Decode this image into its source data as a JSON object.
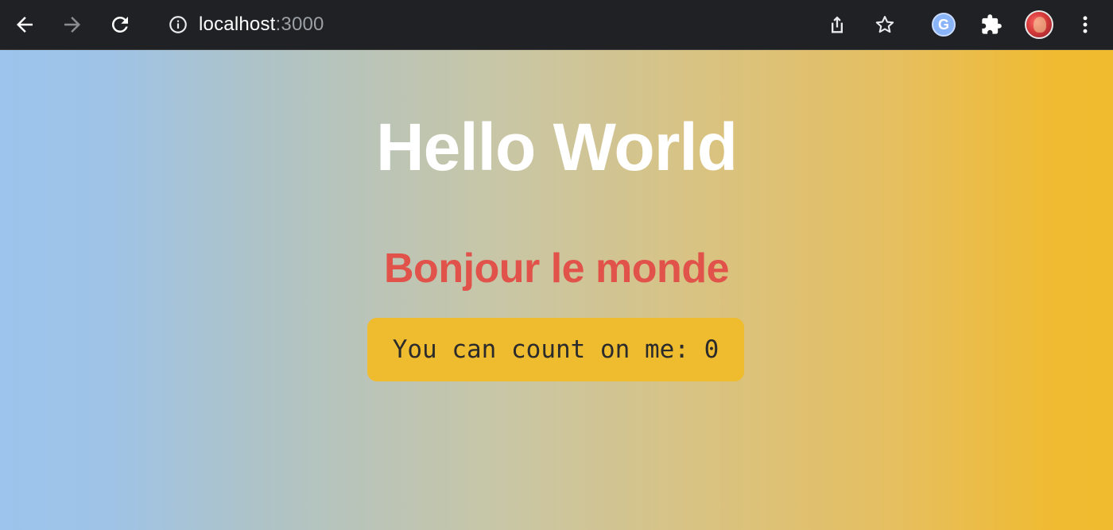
{
  "browser": {
    "url_host": "localhost",
    "url_port": ":3000",
    "icons": {
      "back": "arrow-left-icon",
      "forward": "arrow-right-icon",
      "reload": "reload-icon",
      "info": "info-icon",
      "share": "share-icon",
      "star": "star-icon",
      "extension_g": "google-extension-icon",
      "extensions": "puzzle-icon",
      "profile": "avatar",
      "menu": "kebab-menu-icon"
    },
    "extension_g_letter": "G"
  },
  "page": {
    "title": "Hello World",
    "subtitle": "Bonjour le monde",
    "counter_text": "You can count on me: 0"
  },
  "colors": {
    "toolbar_bg": "#202124",
    "gradient_start": "#9cc4ec",
    "gradient_end": "#f0bb2f",
    "title": "#ffffff",
    "subtitle": "#e0524a",
    "counter_bg": "#f0bc2f",
    "counter_text": "#2b2b2b"
  }
}
